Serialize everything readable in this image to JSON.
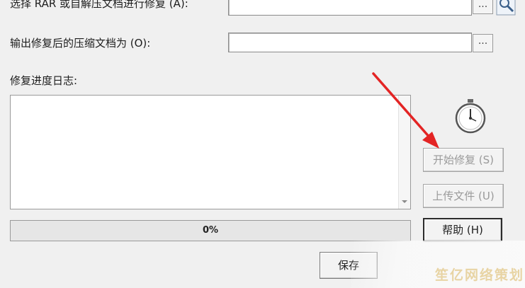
{
  "form": {
    "select_label": "选择 RAR 或自解压文档进行修复 (A):",
    "output_label": "输出修复后的压缩文档为 (O):",
    "log_label": "修复进度日志:",
    "browse_label": "...",
    "select_value": "",
    "output_value": ""
  },
  "buttons": {
    "start": "开始修复 (S)",
    "upload": "上传文件 (U)",
    "help": "帮助 (H)",
    "save": "保存"
  },
  "progress": {
    "text": "0%",
    "fraction": 0
  },
  "icons": {
    "stopwatch": "stopwatch-icon",
    "search": "search-icon",
    "arrow": "red-arrow-annotation"
  },
  "colors": {
    "arrow": "#e32424",
    "watermark": "#e8d4a4"
  },
  "watermark": "笙亿网络策划"
}
